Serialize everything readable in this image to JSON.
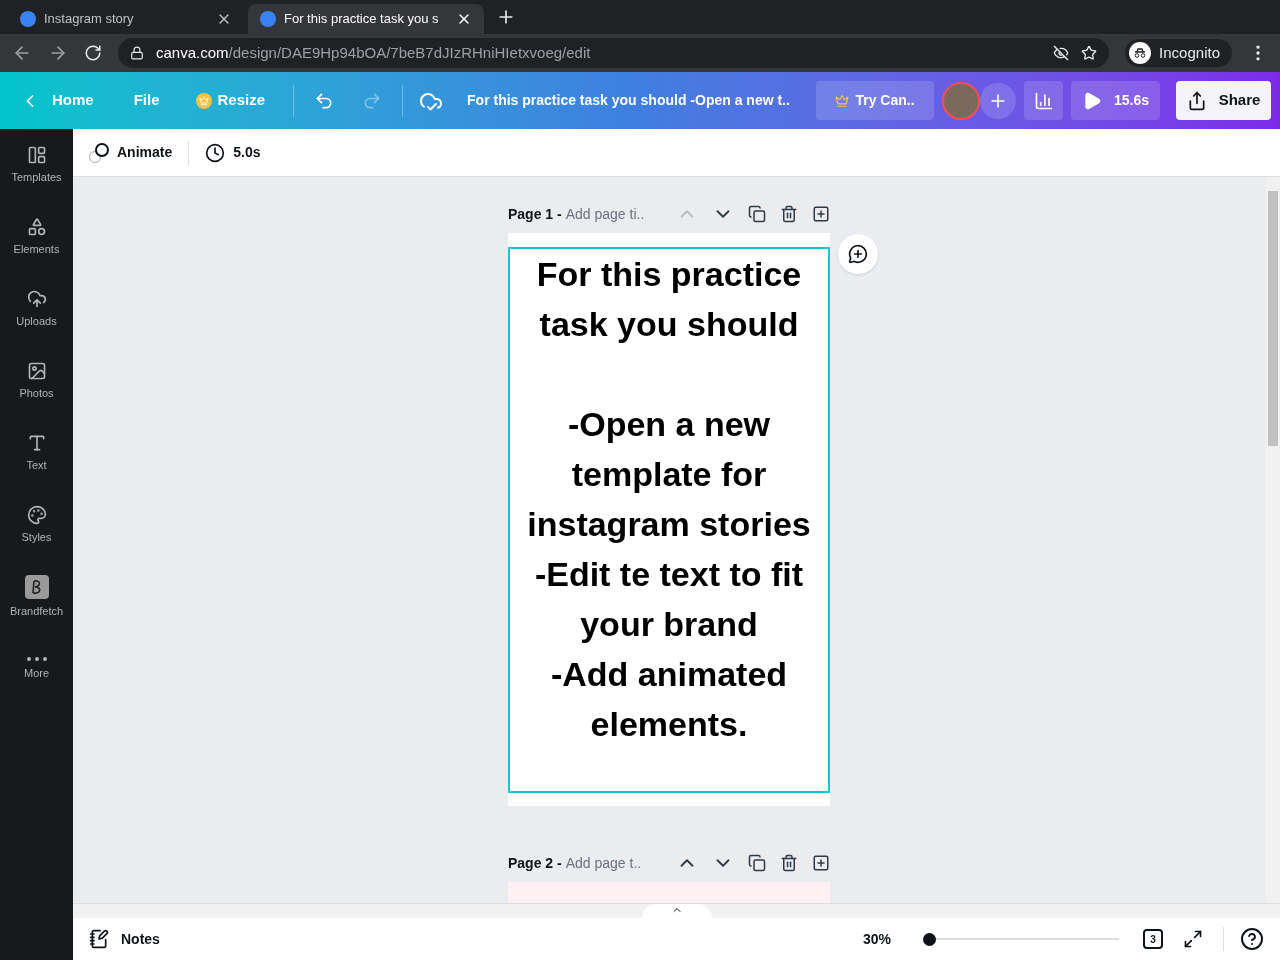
{
  "browser": {
    "tabs": [
      {
        "title": "Instagram story",
        "selected": false
      },
      {
        "title": "For this practice task you s",
        "selected": true
      }
    ],
    "url_host": "canva.com",
    "url_path": "/design/DAE9Hp94bOA/7beB7dJIzRHniHIetxvoeg/edit",
    "profile": "Incognito"
  },
  "header": {
    "home": "Home",
    "file": "File",
    "resize": "Resize",
    "design_title": "For this practice task you should -Open a new t..",
    "try": "Try Can..",
    "duration": "15.6s",
    "share": "Share"
  },
  "sidebar": {
    "items": [
      {
        "kind": "templates",
        "label": "Templates"
      },
      {
        "kind": "elements",
        "label": "Elements"
      },
      {
        "kind": "uploads",
        "label": "Uploads"
      },
      {
        "kind": "photos",
        "label": "Photos"
      },
      {
        "kind": "text",
        "label": "Text"
      },
      {
        "kind": "styles",
        "label": "Styles"
      },
      {
        "kind": "brandfetch",
        "label": "Brandfetch"
      },
      {
        "kind": "more",
        "label": "More"
      }
    ]
  },
  "toolbar": {
    "animate": "Animate",
    "duration": "5.0s"
  },
  "pages": [
    {
      "label": "Page 1 -",
      "title_hint": "Add page ti..",
      "text": [
        "For this practice task you should",
        "-Open a new template for instagram stories",
        "-Edit te text to fit your brand",
        "-Add animated elements."
      ]
    },
    {
      "label": "Page 2 -",
      "title_hint": "Add page t.."
    }
  ],
  "bottom_bar": {
    "notes": "Notes",
    "zoom": "30%",
    "zoom_slider": {
      "level": 0
    },
    "page_count": "3"
  }
}
